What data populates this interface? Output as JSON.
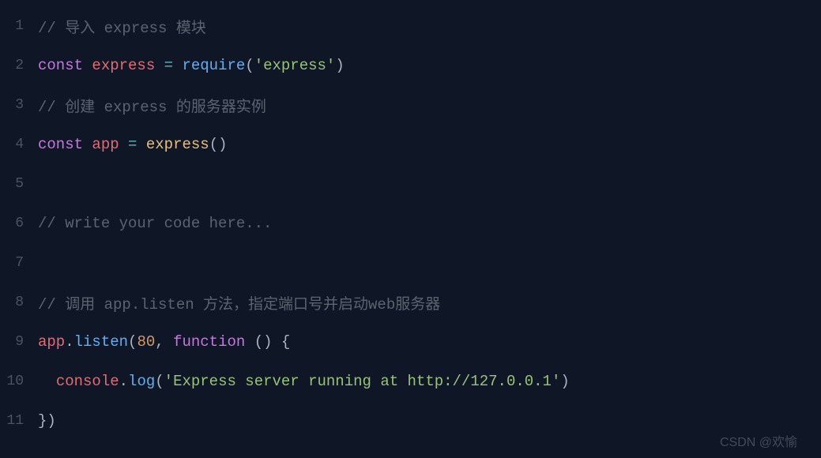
{
  "lines": {
    "n1": "1",
    "n2": "2",
    "n3": "3",
    "n4": "4",
    "n5": "5",
    "n6": "6",
    "n7": "7",
    "n8": "8",
    "n9": "9",
    "n10": "10",
    "n11": "11"
  },
  "l1": {
    "comment": "// 导入 express 模块"
  },
  "l2": {
    "const": "const",
    "sp": " ",
    "var": "express",
    "eq": " = ",
    "req": "require",
    "op": "(",
    "str": "'express'",
    "cp": ")"
  },
  "l3": {
    "comment": "// 创建 express 的服务器实例"
  },
  "l4": {
    "const": "const",
    "sp": " ",
    "var": "app",
    "eq": " = ",
    "fn": "express",
    "par": "()"
  },
  "l6": {
    "comment": "// write your code here..."
  },
  "l8": {
    "comment": "// 调用 app.listen 方法，指定端口号并启动web服务器"
  },
  "l9": {
    "obj": "app",
    "dot": ".",
    "method": "listen",
    "op": "(",
    "num": "80",
    "comma": ", ",
    "fnkw": "function",
    "rest": " () {"
  },
  "l10": {
    "indent": "  ",
    "obj": "console",
    "dot": ".",
    "method": "log",
    "op": "(",
    "str": "'Express server running at http://127.0.0.1'",
    "cp": ")"
  },
  "l11": {
    "close": "})"
  },
  "watermark": "CSDN @欢愉"
}
